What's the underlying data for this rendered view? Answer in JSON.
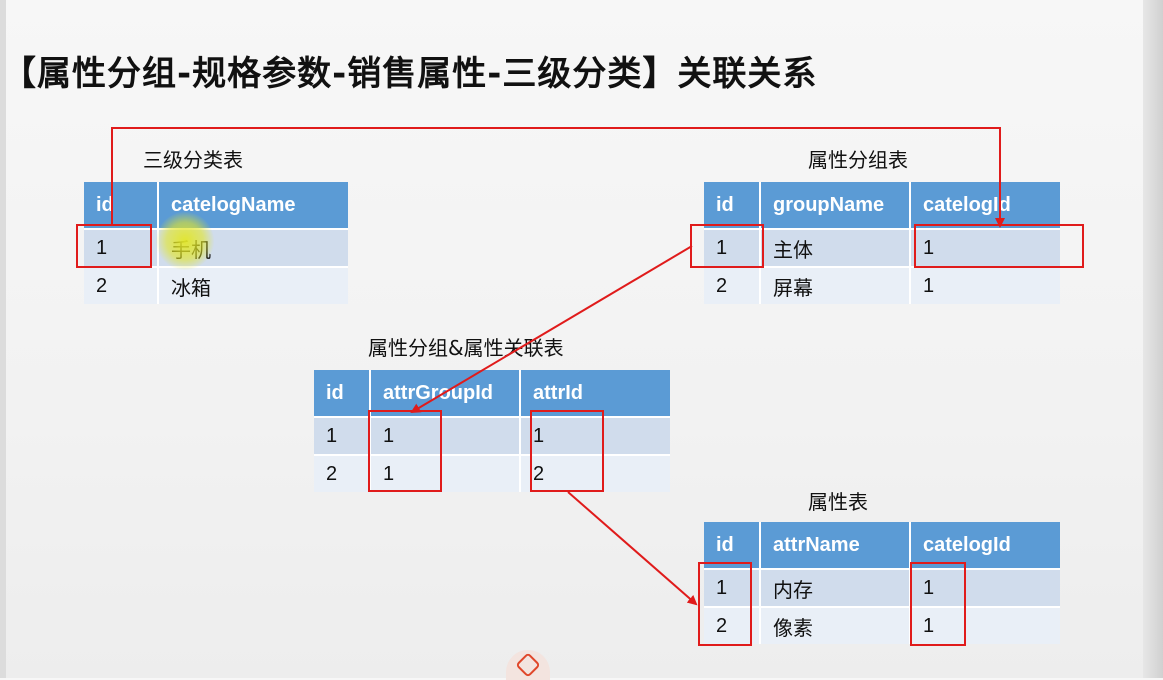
{
  "title": "【属性分组-规格参数-销售属性-三级分类】关联关系",
  "colors": {
    "header_bg": "#5b9bd5",
    "row_odd": "#d0dcec",
    "row_even": "#e9eff7",
    "highlight": "#e01b1b"
  },
  "tables": {
    "category": {
      "caption": "三级分类表",
      "headers": [
        "id",
        "catelogName"
      ],
      "rows": [
        [
          "1",
          "手机"
        ],
        [
          "2",
          "冰箱"
        ]
      ]
    },
    "attr_group": {
      "caption": "属性分组表",
      "headers": [
        "id",
        "groupName",
        "catelogId"
      ],
      "rows": [
        [
          "1",
          "主体",
          "1"
        ],
        [
          "2",
          "屏幕",
          "1"
        ]
      ]
    },
    "relation": {
      "caption": "属性分组&属性关联表",
      "headers": [
        "id",
        "attrGroupId",
        "attrId"
      ],
      "rows": [
        [
          "1",
          "1",
          "1"
        ],
        [
          "2",
          "1",
          "2"
        ]
      ]
    },
    "attr": {
      "caption": "属性表",
      "headers": [
        "id",
        "attrName",
        "catelogId"
      ],
      "rows": [
        [
          "1",
          "内存",
          "1"
        ],
        [
          "2",
          "像素",
          "1"
        ]
      ]
    }
  },
  "icons": {
    "bottom_logo": "m-logo-icon"
  }
}
